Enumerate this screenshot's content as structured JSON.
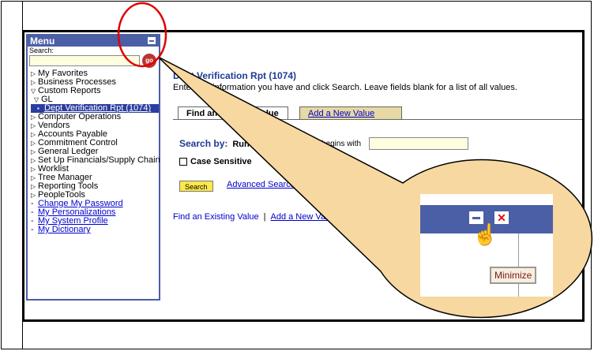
{
  "menu": {
    "title": "Menu",
    "search_label": "Search:",
    "go_label": "go",
    "items": [
      {
        "type": "folder",
        "label": "My Favorites"
      },
      {
        "type": "folder",
        "label": "Business Processes"
      },
      {
        "type": "open",
        "label": "Custom Reports"
      },
      {
        "type": "open-sub",
        "label": "GL"
      },
      {
        "type": "selected",
        "label": "Dept Verification Rpt (1074)"
      },
      {
        "type": "folder",
        "label": "Computer Operations"
      },
      {
        "type": "folder",
        "label": "Vendors"
      },
      {
        "type": "folder",
        "label": "Accounts Payable"
      },
      {
        "type": "folder",
        "label": "Commitment Control"
      },
      {
        "type": "folder",
        "label": "General Ledger"
      },
      {
        "type": "folder",
        "label": "Set Up Financials/Supply Chain"
      },
      {
        "type": "folder",
        "label": "Worklist"
      },
      {
        "type": "folder",
        "label": "Tree Manager"
      },
      {
        "type": "folder",
        "label": "Reporting Tools"
      },
      {
        "type": "folder",
        "label": "PeopleTools"
      },
      {
        "type": "link",
        "label": "Change My Password"
      },
      {
        "type": "link",
        "label": "My Personalizations"
      },
      {
        "type": "link",
        "label": "My System Profile"
      },
      {
        "type": "link",
        "label": "My Dictionary"
      }
    ]
  },
  "main": {
    "title": "Dept Verification Rpt (1074)",
    "instructions": "Enter any information you have and click Search. Leave fields blank for a list of all values.",
    "tabs": [
      {
        "label": "Find an Existing Value"
      },
      {
        "label": "Add a New Value"
      }
    ],
    "search_by_label": "Search by:",
    "search_by_field": "Run Control ID",
    "operator": "begins with",
    "search_by_value": "",
    "case_sensitive_label": "Case Sensitive",
    "search_button": "Search",
    "advanced_search": "Advanced Search",
    "bottom_links": [
      "Find an Existing Value",
      "Add a New Value"
    ]
  },
  "callout": {
    "tooltip": "Minimize"
  },
  "colors": {
    "menu_blue": "#4b5fa7",
    "link_blue": "#0000cc",
    "callout_fill": "#f7d8a0",
    "highlight_circle": "#e00000"
  }
}
